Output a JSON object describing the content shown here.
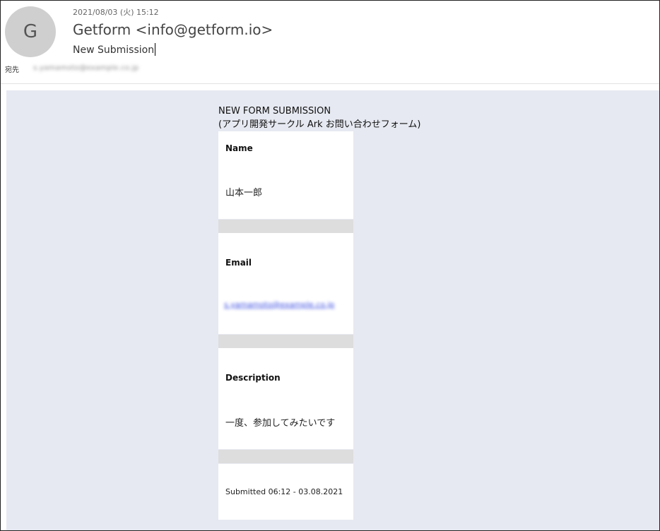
{
  "header": {
    "avatar_letter": "G",
    "datetime": "2021/08/03 (火) 15:12",
    "sender": "Getform <info@getform.io>",
    "subject": "New Submission",
    "to_label": "宛先",
    "to_value": "s.yamamoto@example.co.jp"
  },
  "body": {
    "title_line1": "NEW FORM SUBMISSION",
    "title_line2": "(アプリ開発サークル Ark お問い合わせフォーム)",
    "fields": [
      {
        "label": "Name",
        "value": "山本一郎"
      },
      {
        "label": "Email",
        "value": "s.yamamoto@example.co.jp"
      },
      {
        "label": "Description",
        "value": "一度、参加してみたいです"
      }
    ],
    "submitted": "Submitted 06:12 - 03.08.2021"
  },
  "colors": {
    "body_background": "#e6e9f1",
    "separator": "#dddddd",
    "link": "#3b4ce0"
  }
}
